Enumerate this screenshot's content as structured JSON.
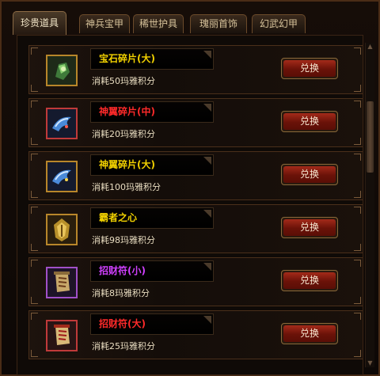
{
  "tabs": [
    {
      "label": "珍贵道具",
      "active": true
    },
    {
      "label": "神兵宝甲",
      "active": false
    },
    {
      "label": "稀世护具",
      "active": false
    },
    {
      "label": "瑰丽首饰",
      "active": false
    },
    {
      "label": "幻武幻甲",
      "active": false
    }
  ],
  "items": [
    {
      "name": "宝石碎片(大)",
      "name_color": "#f0d000",
      "cost": "消耗50玛雅积分",
      "button": "兑换",
      "icon": "gem-fragment-icon",
      "frame_color": "#b8862a"
    },
    {
      "name": "神翼碎片(中)",
      "name_color": "#ff2a2a",
      "cost": "消耗20玛雅积分",
      "button": "兑换",
      "icon": "wing-fragment-icon",
      "frame_color": "#c03a3a"
    },
    {
      "name": "神翼碎片(大)",
      "name_color": "#f0d000",
      "cost": "消耗100玛雅积分",
      "button": "兑换",
      "icon": "wing-fragment-icon",
      "frame_color": "#b8862a"
    },
    {
      "name": "霸者之心",
      "name_color": "#f0d000",
      "cost": "消耗98玛雅积分",
      "button": "兑换",
      "icon": "overlord-heart-icon",
      "frame_color": "#b8862a"
    },
    {
      "name": "招财符(小)",
      "name_color": "#d040ff",
      "cost": "消耗8玛雅积分",
      "button": "兑换",
      "icon": "fortune-talisman-icon",
      "frame_color": "#a050c8"
    },
    {
      "name": "招财符(大)",
      "name_color": "#ff2a2a",
      "cost": "消耗25玛雅积分",
      "button": "兑换",
      "icon": "fortune-talisman-icon",
      "frame_color": "#c03a3a"
    }
  ]
}
